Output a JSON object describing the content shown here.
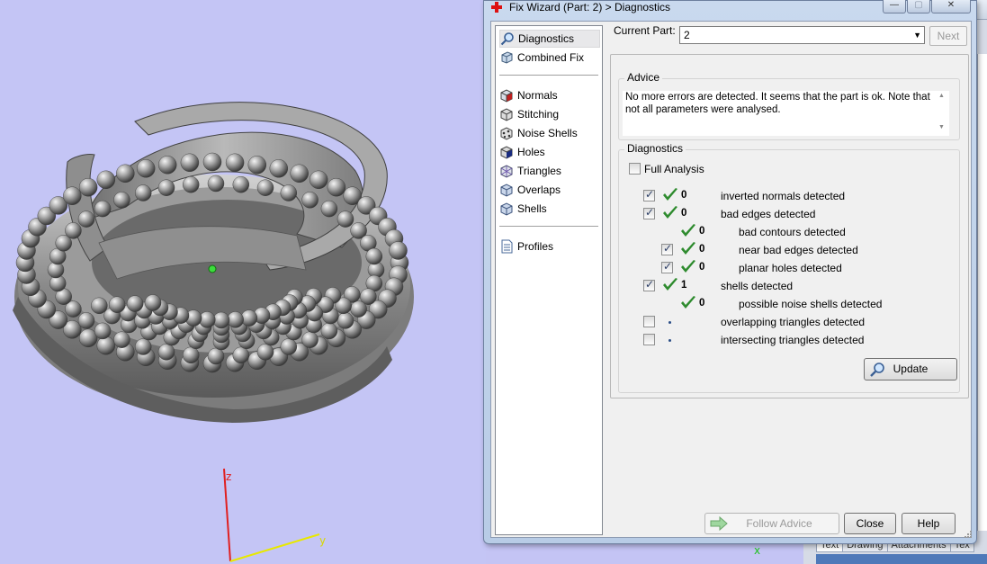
{
  "viewport": {
    "axis_labels": {
      "z": "z",
      "y": "y",
      "x": "x"
    }
  },
  "dialog": {
    "title": "Fix Wizard (Part: 2) > Diagnostics",
    "title_buttons": {
      "minimize": "—",
      "maximize": "▢",
      "close": "✕"
    },
    "nav": {
      "items": [
        {
          "label": "Diagnostics",
          "icon": "magnifier-icon",
          "selected": true
        },
        {
          "label": "Combined Fix",
          "icon": "cube-icon"
        },
        {
          "label": "Normals",
          "icon": "normals-cube-icon"
        },
        {
          "label": "Stitching",
          "icon": "stitching-icon"
        },
        {
          "label": "Noise Shells",
          "icon": "noise-shells-icon"
        },
        {
          "label": "Holes",
          "icon": "holes-icon"
        },
        {
          "label": "Triangles",
          "icon": "triangles-icon"
        },
        {
          "label": "Overlaps",
          "icon": "overlaps-icon"
        },
        {
          "label": "Shells",
          "icon": "shells-icon"
        },
        {
          "label": "Profiles",
          "icon": "document-icon"
        }
      ]
    },
    "current_part": {
      "label": "Current Part:",
      "value": "2"
    },
    "next_button": "Next",
    "advice": {
      "title": "Advice",
      "text": "No more errors are detected. It seems that the part is ok. Note that not all parameters were analysed."
    },
    "diagnostics": {
      "title": "Diagnostics",
      "full_analysis": {
        "label": "Full Analysis",
        "checked": false
      },
      "rows": [
        {
          "checked": true,
          "status": "ok",
          "count": "0",
          "label": "inverted normals detected",
          "indent": 0
        },
        {
          "checked": true,
          "status": "ok",
          "count": "0",
          "label": "bad edges detected",
          "indent": 0
        },
        {
          "checked": null,
          "status": "ok",
          "count": "0",
          "label": "bad contours detected",
          "indent": 1
        },
        {
          "checked": true,
          "status": "ok",
          "count": "0",
          "label": "near bad edges detected",
          "indent": 1
        },
        {
          "checked": true,
          "status": "ok",
          "count": "0",
          "label": "planar holes detected",
          "indent": 1
        },
        {
          "checked": true,
          "status": "ok",
          "count": "1",
          "label": "shells detected",
          "indent": 0
        },
        {
          "checked": null,
          "status": "ok",
          "count": "0",
          "label": "possible noise shells detected",
          "indent": 1
        },
        {
          "checked": false,
          "status": "none",
          "count": "",
          "label": "overlapping triangles detected",
          "indent": 0
        },
        {
          "checked": false,
          "status": "none",
          "count": "",
          "label": "intersecting triangles detected",
          "indent": 0
        }
      ],
      "update_button": "Update"
    },
    "buttons": {
      "follow_advice": "Follow Advice",
      "close": "Close",
      "help": "Help"
    }
  },
  "background_app": {
    "tabs": [
      "Text",
      "Drawing",
      "Attachments",
      "Tex"
    ]
  },
  "colors": {
    "viewport_bg": "#c4c5f5",
    "check_green": "#2e8b2e",
    "axis_z": "#e02020",
    "axis_y": "#f0f000",
    "axis_x": "#20c020"
  }
}
